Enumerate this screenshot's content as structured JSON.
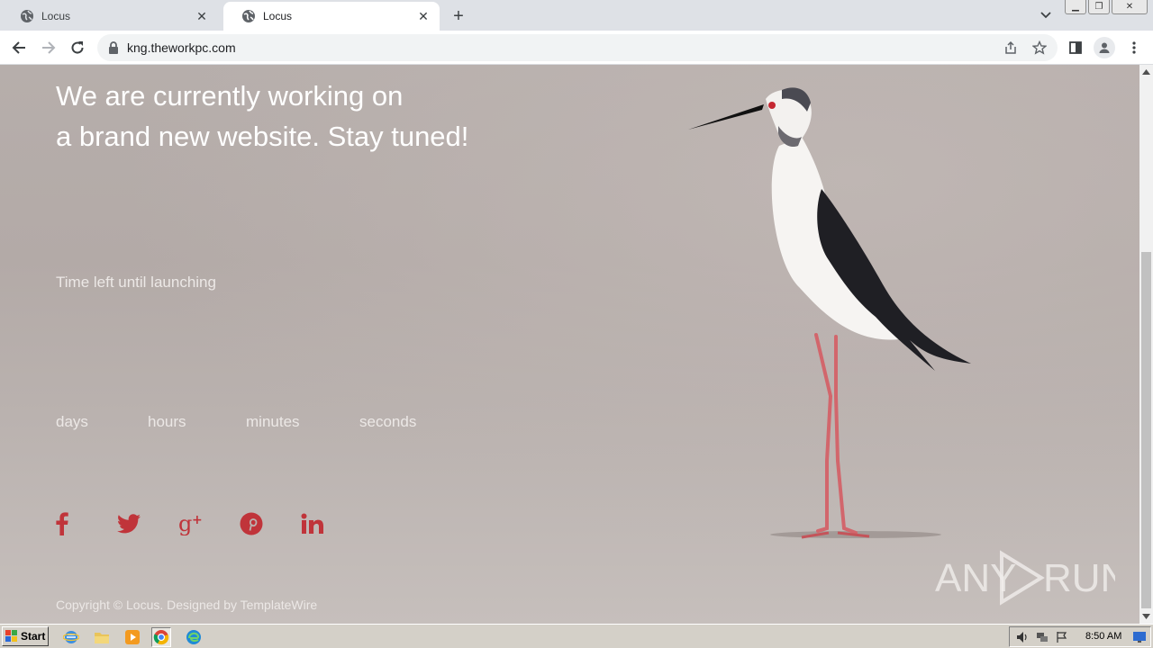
{
  "browser": {
    "tabs": [
      {
        "title": "Locus",
        "active": false
      },
      {
        "title": "Locus",
        "active": true
      }
    ],
    "url": "kng.theworkpc.com"
  },
  "page": {
    "headline_line1": "We are currently working on",
    "headline_line2": "a brand new website. Stay tuned!",
    "subhead": "Time left until launching",
    "countdown": {
      "days_label": "days",
      "hours_label": "hours",
      "minutes_label": "minutes",
      "seconds_label": "seconds"
    },
    "social": [
      {
        "icon": "facebook-icon"
      },
      {
        "icon": "twitter-icon"
      },
      {
        "icon": "google-plus-icon"
      },
      {
        "icon": "pinterest-icon"
      },
      {
        "icon": "linkedin-icon"
      }
    ],
    "copyright": "Copyright © Locus. Designed by TemplateWire",
    "watermark": "ANY RUN",
    "colors": {
      "social": "#c0343a",
      "text": "#ffffff"
    }
  },
  "taskbar": {
    "start_label": "Start",
    "clock": "8:50 AM"
  }
}
